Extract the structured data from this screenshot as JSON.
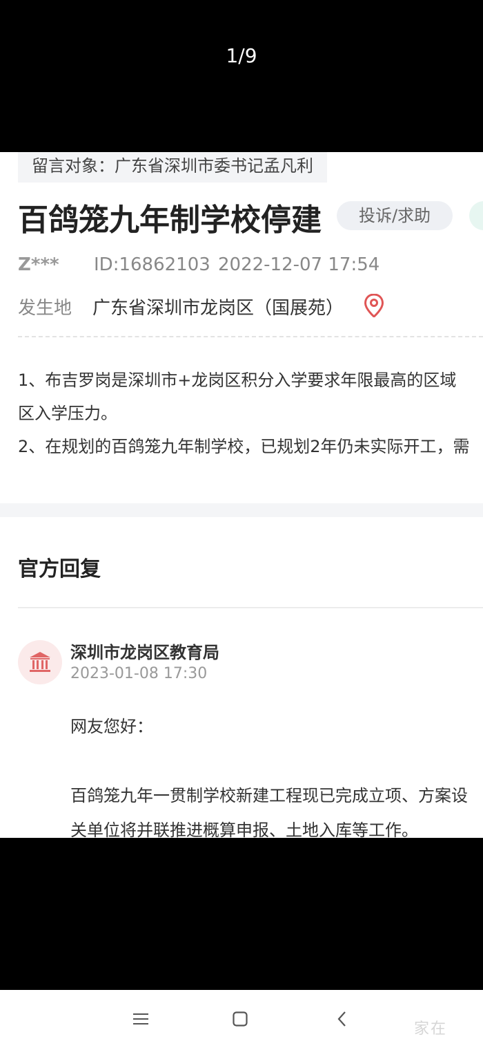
{
  "viewer": {
    "counter": "1/9"
  },
  "post": {
    "target": "留言对象：广东省深圳市委书记孟凡利",
    "title": "百鸽笼九年制学校停建",
    "badge": "投诉/求助",
    "user": "Z***",
    "id": "ID:16862103",
    "date": "2022-12-07 17:54",
    "location_label": "发生地",
    "location": "广东省深圳市龙岗区（国展苑）",
    "paragraphs": [
      "1、布吉罗岗是深圳市+龙岗区积分入学要求年限最高的区域",
      "区入学压力。",
      "2、在规划的百鸽笼九年制学校，已规划2年仍未实际开工，需"
    ]
  },
  "reply": {
    "heading": "官方回复",
    "org": "深圳市龙岗区教育局",
    "date": "2023-01-08 17:30",
    "greeting": "网友您好：",
    "lines": [
      "百鸽笼九年一贯制学校新建工程现已完成立项、方案设",
      "关单位将并联推进概算申报、土地入库等工作。"
    ]
  },
  "navbar": {
    "icons": [
      "menu-icon",
      "home-square-icon",
      "back-chevron-icon"
    ]
  },
  "watermark": "家在"
}
